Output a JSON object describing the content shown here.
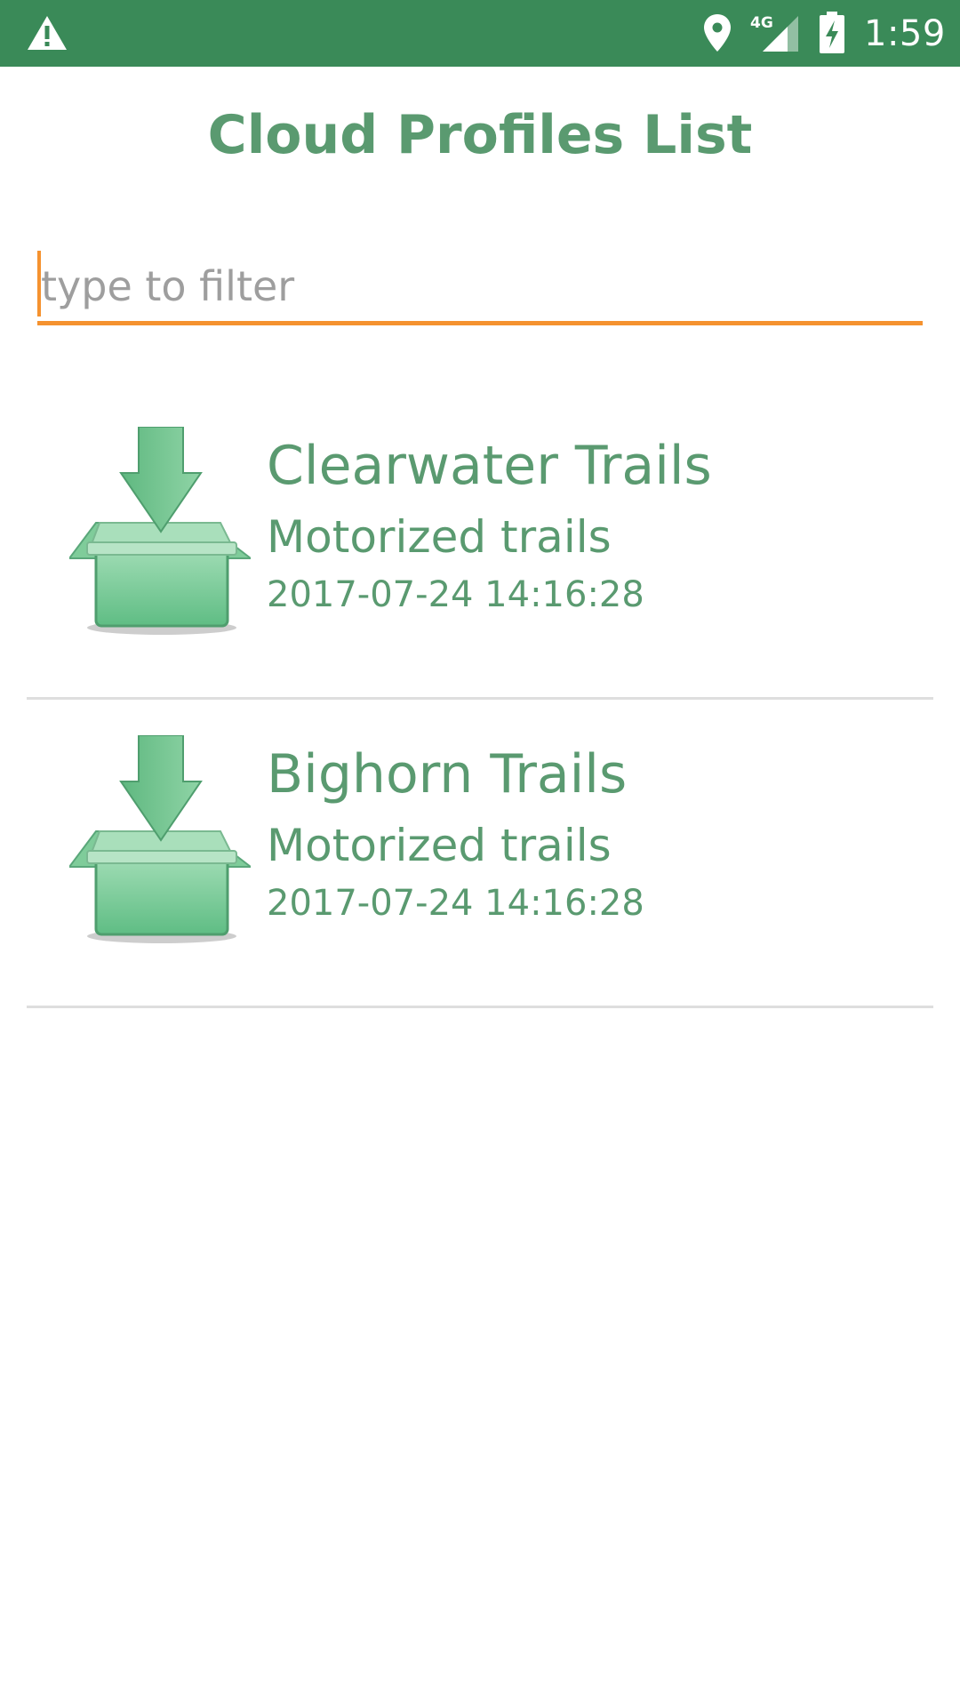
{
  "status_bar": {
    "time": "1:59",
    "network_label": "4G",
    "background_color": "#3a8a58",
    "icons": [
      "warning-icon",
      "location-icon",
      "cell-signal-icon",
      "battery-charging-icon"
    ]
  },
  "page": {
    "title": "Cloud Profiles List",
    "title_color": "#5a9a70"
  },
  "filter": {
    "placeholder": "type to filter",
    "value": "",
    "accent_color": "#f5922f"
  },
  "profiles": [
    {
      "name": "Clearwater Trails",
      "description": "Motorized trails",
      "date": "2017-07-24 14:16:28",
      "icon": "download-box-icon"
    },
    {
      "name": "Bighorn Trails",
      "description": "Motorized trails",
      "date": "2017-07-24 14:16:28",
      "icon": "download-box-icon"
    }
  ]
}
